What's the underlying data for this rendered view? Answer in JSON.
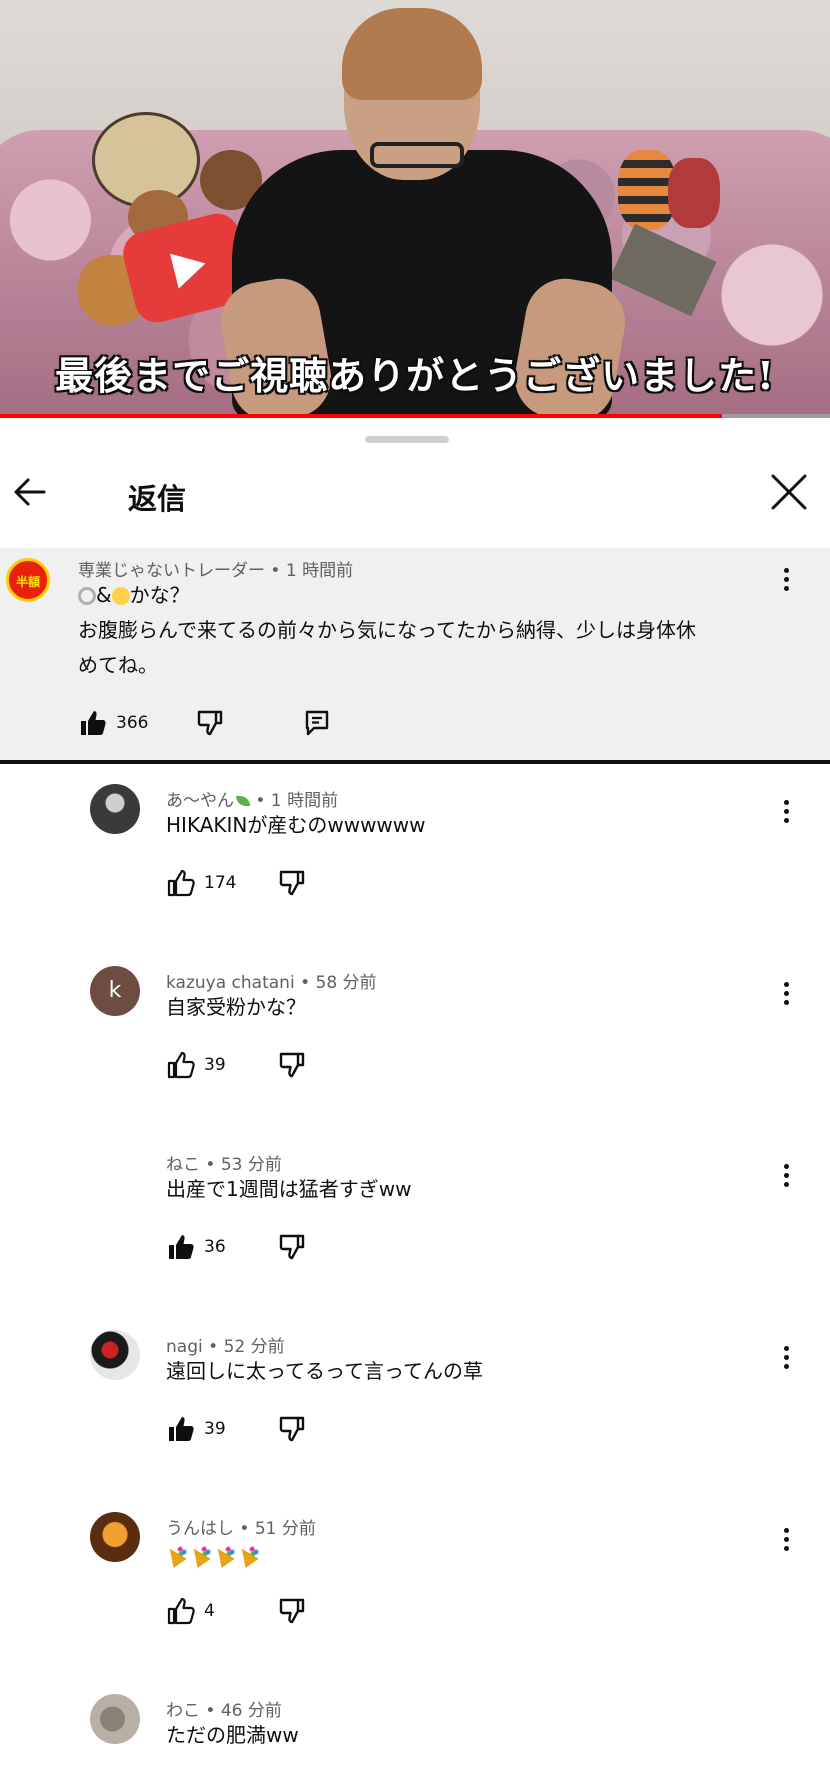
{
  "video": {
    "caption": "最後までご視聴ありがとうございました!",
    "progress": 0.87
  },
  "header": {
    "title": "返信"
  },
  "parent_comment": {
    "avatar_text": "半額",
    "author": "専業じゃないトレーダー",
    "time": "1 時間前",
    "emoji_prefix": [
      "ring-emoji",
      "baby-emoji"
    ],
    "text_line1_suffix": "&",
    "text_line1_tail": "かな？",
    "text_line2": "お腹膨らんで来てるの前々から気になってたから納得、少しは身体休",
    "text_line3": "めてね。",
    "likes": "366",
    "liked": true
  },
  "replies": [
    {
      "author": "あ～やん",
      "author_emoji": "leaf-emoji",
      "time": "1 時間前",
      "text": "HIKAKINが産むのwwwwww",
      "likes": "174",
      "liked": false,
      "avatar": "dark-photo",
      "avatar_letter": ""
    },
    {
      "author": "kazuya chatani",
      "time": "58 分前",
      "text": "自家受粉かな？",
      "likes": "39",
      "liked": false,
      "avatar": "letter",
      "avatar_letter": "k",
      "avatar_color": "#6d4c41"
    },
    {
      "author": "ねこ",
      "time": "53 分前",
      "text": "出産で1週間は猛者すぎww",
      "likes": "36",
      "liked": true,
      "avatar": "none",
      "avatar_letter": ""
    },
    {
      "author": "nagi",
      "time": "52 分前",
      "text": "遠回しに太ってるって言ってんの草",
      "likes": "39",
      "liked": true,
      "avatar": "red-black-photo",
      "avatar_letter": ""
    },
    {
      "author": "うんはし",
      "time": "51 分前",
      "text": "",
      "text_emoji": [
        "party-popper",
        "party-popper",
        "party-popper",
        "party-popper"
      ],
      "likes": "4",
      "liked": false,
      "avatar": "orange-photo",
      "avatar_letter": ""
    },
    {
      "author": "わこ",
      "time": "46 分前",
      "text": "ただの肥満ww",
      "likes": "",
      "liked": false,
      "avatar": "cat-photo",
      "avatar_letter": ""
    }
  ],
  "icons": {
    "back": "arrow-left-icon",
    "close": "close-icon",
    "menu": "more-vertical-icon",
    "like": "thumb-up-icon",
    "dislike": "thumb-down-icon",
    "reply": "comment-icon"
  },
  "colors": {
    "progress": "#ff0000",
    "meta_text": "#606060",
    "highlight_bg": "#f0f0f0"
  }
}
